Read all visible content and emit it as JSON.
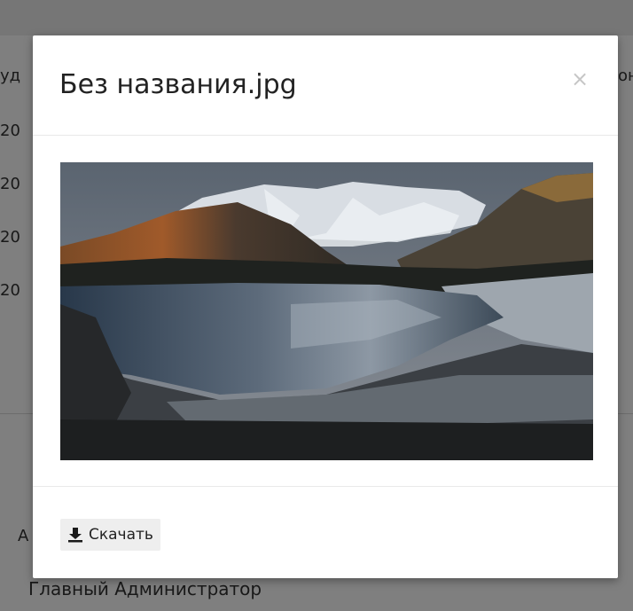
{
  "background": {
    "header_fragment_left": "уд",
    "header_fragment_right": "он",
    "rows": [
      "20",
      "20",
      "20",
      "20"
    ],
    "footer_fragment": "А",
    "role_text": "Главный Администратор"
  },
  "modal": {
    "title": "Без названия.jpg",
    "close_glyph": "×",
    "image_icon": "mountain-lake-photo",
    "download_label": "Скачать",
    "download_icon": "download-icon"
  },
  "colors": {
    "overlay": "#000000",
    "modal_bg": "#ffffff",
    "button_bg": "#eeeeee"
  }
}
